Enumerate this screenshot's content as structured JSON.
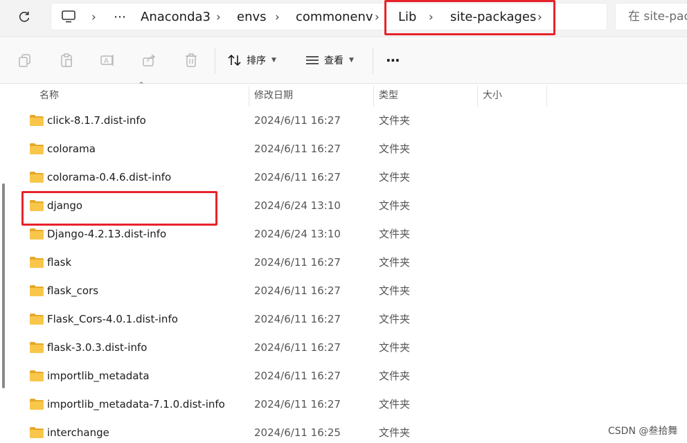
{
  "breadcrumb": {
    "ellipsis": "⋯",
    "items": [
      "Anaconda3",
      "envs",
      "commonenv",
      "Lib",
      "site-packages"
    ]
  },
  "search": {
    "placeholder": "在 site-packages 中搜索"
  },
  "toolbar": {
    "sort_label": "排序",
    "view_label": "查看",
    "more_label": "⋯"
  },
  "columns": {
    "name": "名称",
    "modified": "修改日期",
    "type": "类型",
    "size": "大小"
  },
  "files": [
    {
      "name": "click-8.1.7.dist-info",
      "modified": "2024/6/11 16:27",
      "type": "文件夹"
    },
    {
      "name": "colorama",
      "modified": "2024/6/11 16:27",
      "type": "文件夹"
    },
    {
      "name": "colorama-0.4.6.dist-info",
      "modified": "2024/6/11 16:27",
      "type": "文件夹"
    },
    {
      "name": "django",
      "modified": "2024/6/24 13:10",
      "type": "文件夹"
    },
    {
      "name": "Django-4.2.13.dist-info",
      "modified": "2024/6/24 13:10",
      "type": "文件夹"
    },
    {
      "name": "flask",
      "modified": "2024/6/11 16:27",
      "type": "文件夹"
    },
    {
      "name": "flask_cors",
      "modified": "2024/6/11 16:27",
      "type": "文件夹"
    },
    {
      "name": "Flask_Cors-4.0.1.dist-info",
      "modified": "2024/6/11 16:27",
      "type": "文件夹"
    },
    {
      "name": "flask-3.0.3.dist-info",
      "modified": "2024/6/11 16:27",
      "type": "文件夹"
    },
    {
      "name": "importlib_metadata",
      "modified": "2024/6/11 16:27",
      "type": "文件夹"
    },
    {
      "name": "importlib_metadata-7.1.0.dist-info",
      "modified": "2024/6/11 16:27",
      "type": "文件夹"
    },
    {
      "name": "interchange",
      "modified": "2024/6/11 16:25",
      "type": "文件夹"
    }
  ],
  "watermark": "CSDN @叁拾舞",
  "colors": {
    "highlight": "#e8222a",
    "folder_body": "#f8c74a",
    "folder_tab": "#e6a829"
  }
}
